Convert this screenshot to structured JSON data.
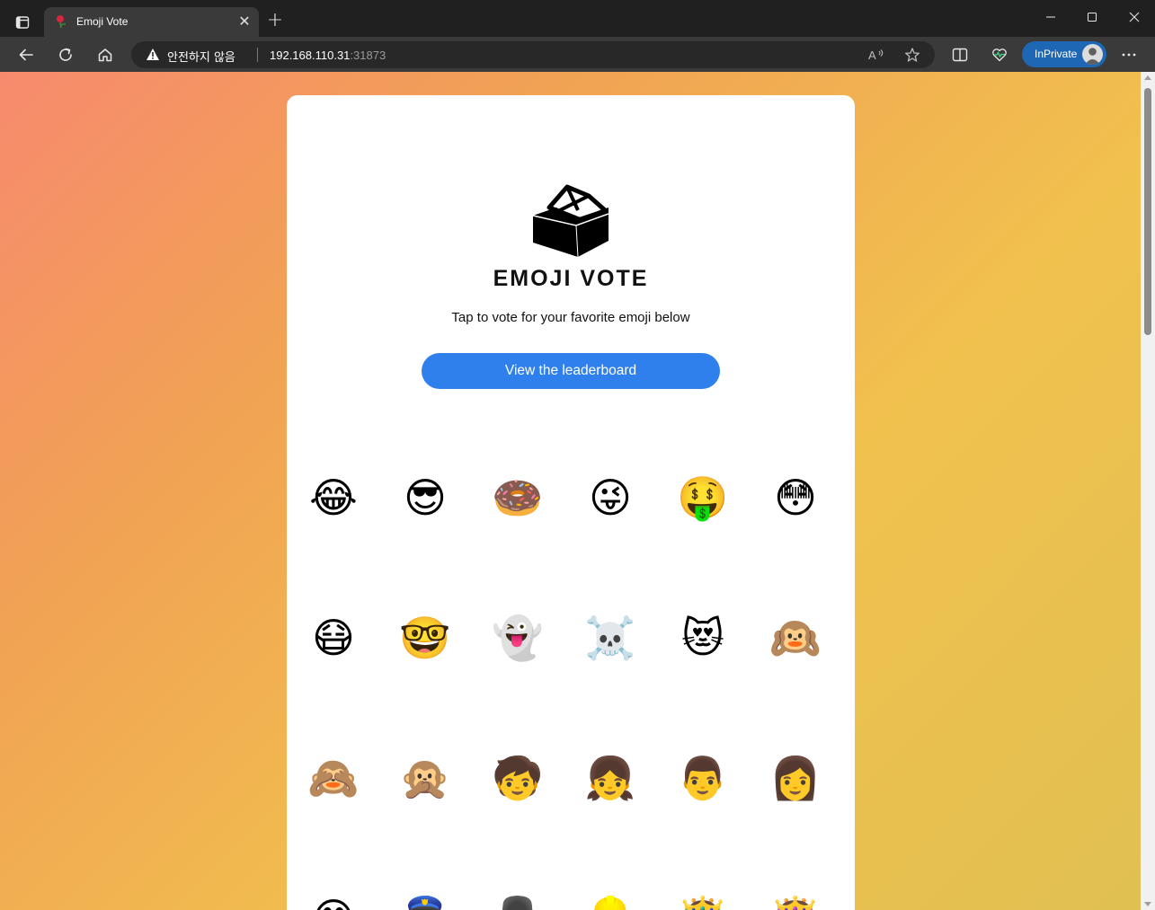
{
  "browser": {
    "tab_title": "Emoji Vote",
    "tab_close": "✕",
    "new_tab": "+",
    "address_warning": "안전하지 않음",
    "address_host": "192.168.110.31",
    "address_port": ":31873",
    "inprivate_label": "InPrivate",
    "window_controls": {
      "minimize": "—",
      "maximize": "☐",
      "close": "✕"
    },
    "more_label": "···"
  },
  "page": {
    "title": "EMOJI VOTE",
    "subtitle": "Tap to vote for your favorite emoji below",
    "leaderboard_button": "View the leaderboard"
  },
  "emojis": [
    [
      "😂",
      "😎",
      "🍩",
      "😜",
      "🤑",
      "😳"
    ],
    [
      "😷",
      "🤓",
      "👻",
      "☠️",
      "😻",
      "🙉"
    ],
    [
      "🙈",
      "🙊",
      "🧒",
      "👧",
      "👨",
      "👩"
    ],
    [
      "😄",
      "👮",
      "💂",
      "👷",
      "🤴",
      "👸"
    ]
  ],
  "colors": {
    "accent": "#2f80ed",
    "inprivate": "#1e67b5",
    "chrome_dark": "#202020",
    "chrome_toolbar": "#3a3a3a"
  }
}
